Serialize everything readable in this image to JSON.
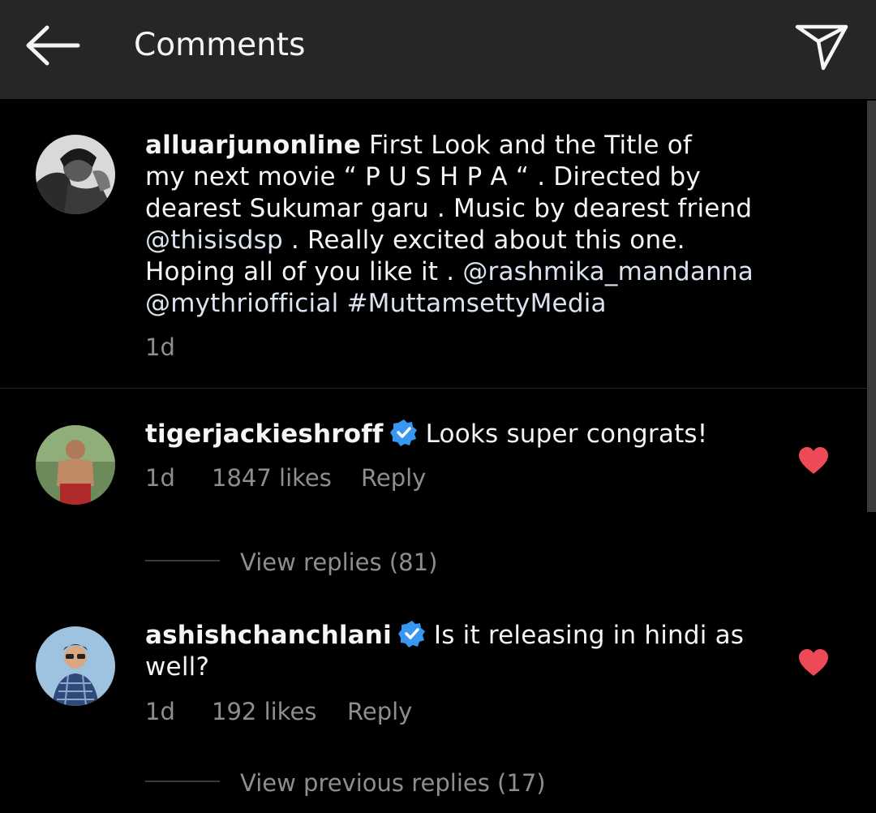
{
  "header": {
    "title": "Comments",
    "back_icon": "arrow-left-icon",
    "share_icon": "paper-plane-icon"
  },
  "caption": {
    "username": "alluarjunonline",
    "lines": [
      "First Look and the Title of",
      "my next movie “ P U S H P A “ . Directed by",
      "dearest Sukumar garu . Music by dearest friend",
      " . Really excited about this one.",
      "Hoping all of you like it . ",
      " "
    ],
    "mentions": {
      "dsp": "@thisisdsp",
      "rashmika": "@rashmika_mandanna",
      "mythri": "@mythriofficial",
      "hashtag": "#MuttamsettyMedia"
    },
    "time": "1d"
  },
  "comments": [
    {
      "username": "tigerjackieshroff",
      "text": "Looks super congrats!",
      "time": "1d",
      "likes": "1847 likes",
      "reply": "Reply",
      "view_replies": "View replies (81)"
    },
    {
      "username": "ashishchanchlani",
      "text_line1": "Is it releasing in hindi as",
      "text_line2": "well?",
      "time": "1d",
      "likes": "192 likes",
      "reply": "Reply",
      "view_replies": "View previous replies (17)"
    }
  ],
  "colors": {
    "background": "#000000",
    "header": "#262626",
    "text": "#f5f5f5",
    "muted": "#8e8e8e",
    "heart": "#ed4956",
    "verified": "#3897f0"
  }
}
